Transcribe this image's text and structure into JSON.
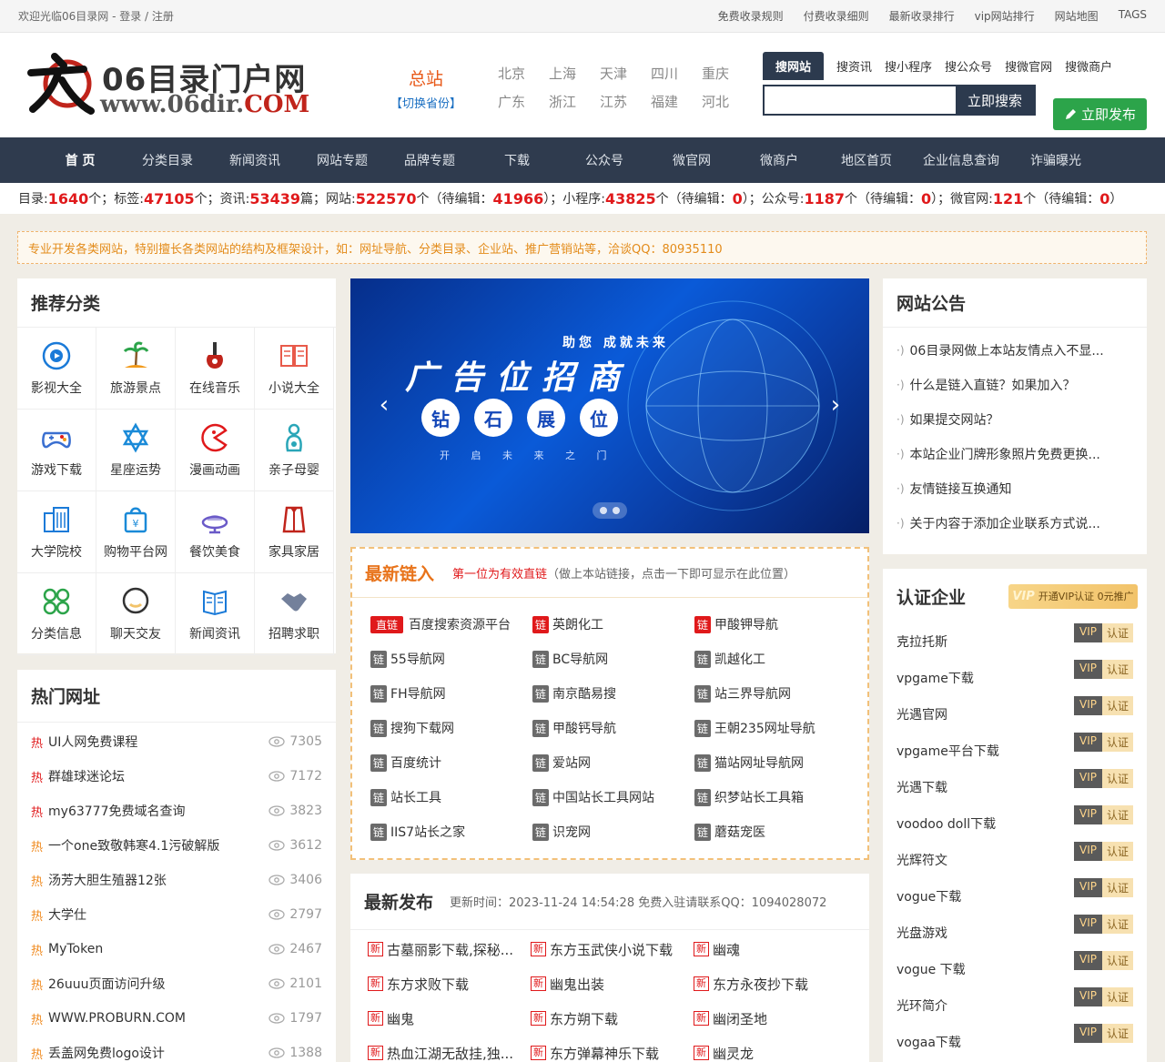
{
  "topbar": {
    "welcome": "欢迎光临06目录网 - 登录 / 注册",
    "links": [
      "免费收录规则",
      "付费收录细则",
      "最新收录排行",
      "vip网站排行",
      "网站地图",
      "TAGS"
    ]
  },
  "logo": {
    "title": "06目录门户网",
    "url_prefix": "www.06dir.",
    "url_suffix": "COM"
  },
  "city": {
    "main": "总站",
    "switch": "【切换省份】"
  },
  "cities": [
    "北京",
    "上海",
    "天津",
    "四川",
    "重庆",
    "广东",
    "浙江",
    "江苏",
    "福建",
    "河北"
  ],
  "search": {
    "tabs": [
      "搜网站",
      "搜资讯",
      "搜小程序",
      "搜公众号",
      "搜微官网",
      "搜微商户"
    ],
    "placeholder": "",
    "button": "立即搜索"
  },
  "publish_label": "立即发布",
  "nav": [
    "首 页",
    "分类目录",
    "新闻资讯",
    "网站专题",
    "品牌专题",
    "下载",
    "公众号",
    "微官网",
    "微商户",
    "地区首页",
    "企业信息查询",
    "诈骗曝光"
  ],
  "stats": {
    "dir_label": "目录:",
    "dir": "1640",
    "dir_unit": "个；标签:",
    "tag": "47105",
    "tag_unit": "个；资讯:",
    "news": "53439",
    "news_unit": "篇；网站:",
    "site": "522570",
    "site_unit": "个（待编辑：",
    "site_pending": "41966",
    "site_end": "）；小程序:",
    "mini": "43825",
    "mini_unit": "个（待编辑：",
    "mini_pending": "0",
    "mini_end": "）；公众号:",
    "mp": "1187",
    "mp_unit": "个（待编辑：",
    "mp_pending": "0",
    "mp_end": "）；微官网:",
    "wx": "121",
    "wx_unit": "个（待编辑：",
    "wx_pending": "0",
    "wx_end": "）"
  },
  "notice": "专业开发各类网站，特别擅长各类网站的结构及框架设计，如：网址导航、分类目录、企业站、推广营销站等，洽谈QQ：80935110",
  "recommend": {
    "title": "推荐分类",
    "items": [
      {
        "label": "影视大全",
        "icon": "film-icon",
        "color": "#1a7ad8"
      },
      {
        "label": "旅游景点",
        "icon": "palm-icon",
        "color": "#f29a1a"
      },
      {
        "label": "在线音乐",
        "icon": "guitar-icon",
        "color": "#c0241b"
      },
      {
        "label": "小说大全",
        "icon": "book-icon",
        "color": "#e85a4a"
      },
      {
        "label": "游戏下载",
        "icon": "gamepad-icon",
        "color": "#3a6fd0"
      },
      {
        "label": "星座运势",
        "icon": "star-icon",
        "color": "#1a8ad8"
      },
      {
        "label": "漫画动画",
        "icon": "pacman-icon",
        "color": "#e0191b"
      },
      {
        "label": "亲子母婴",
        "icon": "baby-icon",
        "color": "#2aa6b8"
      },
      {
        "label": "大学院校",
        "icon": "building-icon",
        "color": "#1a7ad8"
      },
      {
        "label": "购物平台网",
        "icon": "bag-icon",
        "color": "#1a8ad8"
      },
      {
        "label": "餐饮美食",
        "icon": "dish-icon",
        "color": "#6a5ac8"
      },
      {
        "label": "家具家居",
        "icon": "wardrobe-icon",
        "color": "#c0241b"
      },
      {
        "label": "分类信息",
        "icon": "grid-icon",
        "color": "#2ca44a"
      },
      {
        "label": "聊天交友",
        "icon": "chat-icon",
        "color": "#333333"
      },
      {
        "label": "新闻资讯",
        "icon": "news-icon",
        "color": "#1a7ad8"
      },
      {
        "label": "招聘求职",
        "icon": "handshake-icon",
        "color": "#5a6a8a"
      }
    ]
  },
  "hot": {
    "title": "热门网址",
    "tag": "热",
    "items": [
      {
        "name": "UI人网免费课程",
        "views": "7305"
      },
      {
        "name": "群雄球迷论坛",
        "views": "7172"
      },
      {
        "name": "my63777免费域名查询",
        "views": "3823"
      },
      {
        "name": "一个one致敬韩寒4.1污破解版",
        "views": "3612"
      },
      {
        "name": "汤芳大胆生殖器12张",
        "views": "3406"
      },
      {
        "name": "大学仕",
        "views": "2797"
      },
      {
        "name": "MyToken",
        "views": "2467"
      },
      {
        "name": "26uuu页面访问升级",
        "views": "2101"
      },
      {
        "name": "WWW.PROBURN.COM",
        "views": "1797"
      },
      {
        "name": "丢盖网免费logo设计",
        "views": "1388"
      }
    ]
  },
  "banner": {
    "sub": "助您 成就未来",
    "main": "广告位招商",
    "pills": [
      "钻",
      "石",
      "展",
      "位"
    ],
    "line": "开 启 未 来 之 门"
  },
  "latest_links": {
    "title": "最新链入",
    "note_red": "第一位为有效直链",
    "note": "（做上本站链接，点击一下即可显示在此位置）",
    "first_badge": "直链",
    "badge": "链",
    "items": [
      "百度搜索资源平台",
      "英朗化工",
      "甲酸钾导航",
      "55导航网",
      "BC导航网",
      "凯越化工",
      "FH导航网",
      "南京酷易搜",
      "站三界导航网",
      "搜狗下载网",
      "甲酸钙导航",
      "王朝235网址导航",
      "百度统计",
      "爱站网",
      "猫站网址导航网",
      "站长工具",
      "中国站长工具网站",
      "织梦站长工具箱",
      "IIS7站长之家",
      "识宠网",
      "蘑菇宠医"
    ]
  },
  "latest_pub": {
    "title": "最新发布",
    "note": "更新时间：2023-11-24 14:54:28 免费入驻请联系QQ：1094028072",
    "badge": "新",
    "items": [
      "古墓丽影下载,探秘...",
      "东方玉武侠小说下载",
      "幽魂",
      "东方求败下载",
      "幽鬼出装",
      "东方永夜抄下载",
      "幽鬼",
      "东方朔下载",
      "幽闭圣地",
      "热血江湖无敌挂,独...",
      "东方弹幕神乐下载",
      "幽灵龙"
    ]
  },
  "announce": {
    "title": "网站公告",
    "items": [
      "06目录网做上本站友情点入不显...",
      "什么是链入直链？如果加入？",
      "如果提交网站？",
      "本站企业门牌形象照片免费更换...",
      "友情链接互换通知",
      "关于内容于添加企业联系方式说..."
    ]
  },
  "certified": {
    "title": "认证企业",
    "vip_btn_logo": "VIP",
    "vip_btn": "开通VIP认证 0元推广",
    "vip": "VIP",
    "cert": "认证",
    "items": [
      "克拉托斯",
      "vpgame下载",
      "光遇官网",
      "vpgame平台下载",
      "光遇下载",
      "voodoo doll下载",
      "光辉符文",
      "vogue下载",
      "光盘游戏",
      "vogue 下载",
      "光环简介",
      "vogaa下载"
    ]
  },
  "colors": {
    "nav_bg": "#2f3b4e",
    "accent_red": "#e0191b",
    "accent_orange": "#e8731a",
    "green": "#2ca44a"
  }
}
